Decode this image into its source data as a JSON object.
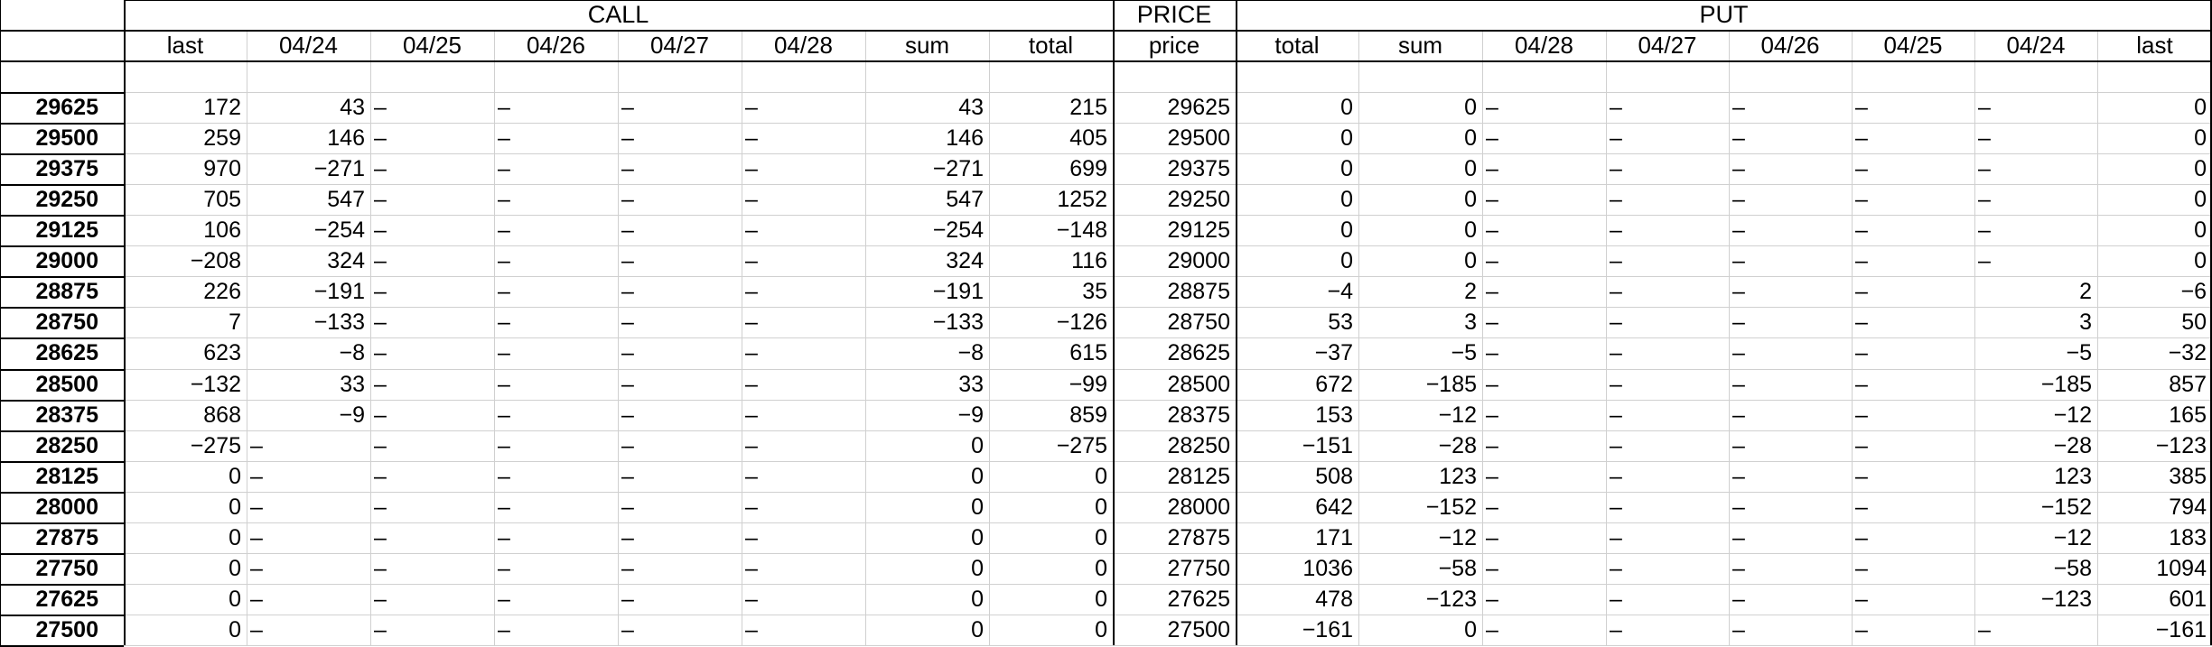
{
  "headers": {
    "group_call": "CALL",
    "group_price": "PRICE",
    "group_put": "PUT",
    "columns": [
      "last",
      "04/24",
      "04/25",
      "04/26",
      "04/27",
      "04/28",
      "sum",
      "total",
      "price",
      "total",
      "sum",
      "04/28",
      "04/27",
      "04/26",
      "04/25",
      "04/24",
      "last"
    ]
  },
  "rows": [
    {
      "label": "29625",
      "cells": [
        "172",
        "43",
        "–",
        "–",
        "–",
        "–",
        "43",
        "215",
        "29625",
        "0",
        "0",
        "–",
        "–",
        "–",
        "–",
        "–",
        "0"
      ]
    },
    {
      "label": "29500",
      "cells": [
        "259",
        "146",
        "–",
        "–",
        "–",
        "–",
        "146",
        "405",
        "29500",
        "0",
        "0",
        "–",
        "–",
        "–",
        "–",
        "–",
        "0"
      ]
    },
    {
      "label": "29375",
      "cells": [
        "970",
        "−271",
        "–",
        "–",
        "–",
        "–",
        "−271",
        "699",
        "29375",
        "0",
        "0",
        "–",
        "–",
        "–",
        "–",
        "–",
        "0"
      ]
    },
    {
      "label": "29250",
      "cells": [
        "705",
        "547",
        "–",
        "–",
        "–",
        "–",
        "547",
        "1252",
        "29250",
        "0",
        "0",
        "–",
        "–",
        "–",
        "–",
        "–",
        "0"
      ]
    },
    {
      "label": "29125",
      "cells": [
        "106",
        "−254",
        "–",
        "–",
        "–",
        "–",
        "−254",
        "−148",
        "29125",
        "0",
        "0",
        "–",
        "–",
        "–",
        "–",
        "–",
        "0"
      ]
    },
    {
      "label": "29000",
      "cells": [
        "−208",
        "324",
        "–",
        "–",
        "–",
        "–",
        "324",
        "116",
        "29000",
        "0",
        "0",
        "–",
        "–",
        "–",
        "–",
        "–",
        "0"
      ]
    },
    {
      "label": "28875",
      "cells": [
        "226",
        "−191",
        "–",
        "–",
        "–",
        "–",
        "−191",
        "35",
        "28875",
        "−4",
        "2",
        "–",
        "–",
        "–",
        "–",
        "2",
        "−6"
      ]
    },
    {
      "label": "28750",
      "cells": [
        "7",
        "−133",
        "–",
        "–",
        "–",
        "–",
        "−133",
        "−126",
        "28750",
        "53",
        "3",
        "–",
        "–",
        "–",
        "–",
        "3",
        "50"
      ]
    },
    {
      "label": "28625",
      "cells": [
        "623",
        "−8",
        "–",
        "–",
        "–",
        "–",
        "−8",
        "615",
        "28625",
        "−37",
        "−5",
        "–",
        "–",
        "–",
        "–",
        "−5",
        "−32"
      ]
    },
    {
      "label": "28500",
      "cells": [
        "−132",
        "33",
        "–",
        "–",
        "–",
        "–",
        "33",
        "−99",
        "28500",
        "672",
        "−185",
        "–",
        "–",
        "–",
        "–",
        "−185",
        "857"
      ]
    },
    {
      "label": "28375",
      "cells": [
        "868",
        "−9",
        "–",
        "–",
        "–",
        "–",
        "−9",
        "859",
        "28375",
        "153",
        "−12",
        "–",
        "–",
        "–",
        "–",
        "−12",
        "165"
      ]
    },
    {
      "label": "28250",
      "cells": [
        "−275",
        "–",
        "–",
        "–",
        "–",
        "–",
        "0",
        "−275",
        "28250",
        "−151",
        "−28",
        "–",
        "–",
        "–",
        "–",
        "−28",
        "−123"
      ]
    },
    {
      "label": "28125",
      "cells": [
        "0",
        "–",
        "–",
        "–",
        "–",
        "–",
        "0",
        "0",
        "28125",
        "508",
        "123",
        "–",
        "–",
        "–",
        "–",
        "123",
        "385"
      ]
    },
    {
      "label": "28000",
      "cells": [
        "0",
        "–",
        "–",
        "–",
        "–",
        "–",
        "0",
        "0",
        "28000",
        "642",
        "−152",
        "–",
        "–",
        "–",
        "–",
        "−152",
        "794"
      ]
    },
    {
      "label": "27875",
      "cells": [
        "0",
        "–",
        "–",
        "–",
        "–",
        "–",
        "0",
        "0",
        "27875",
        "171",
        "−12",
        "–",
        "–",
        "–",
        "–",
        "−12",
        "183"
      ]
    },
    {
      "label": "27750",
      "cells": [
        "0",
        "–",
        "–",
        "–",
        "–",
        "–",
        "0",
        "0",
        "27750",
        "1036",
        "−58",
        "–",
        "–",
        "–",
        "–",
        "−58",
        "1094"
      ]
    },
    {
      "label": "27625",
      "cells": [
        "0",
        "–",
        "–",
        "–",
        "–",
        "–",
        "0",
        "0",
        "27625",
        "478",
        "−123",
        "–",
        "–",
        "–",
        "–",
        "−123",
        "601"
      ]
    },
    {
      "label": "27500",
      "cells": [
        "0",
        "–",
        "–",
        "–",
        "–",
        "–",
        "0",
        "0",
        "27500",
        "−161",
        "0",
        "–",
        "–",
        "–",
        "–",
        "–",
        "−161"
      ]
    }
  ]
}
